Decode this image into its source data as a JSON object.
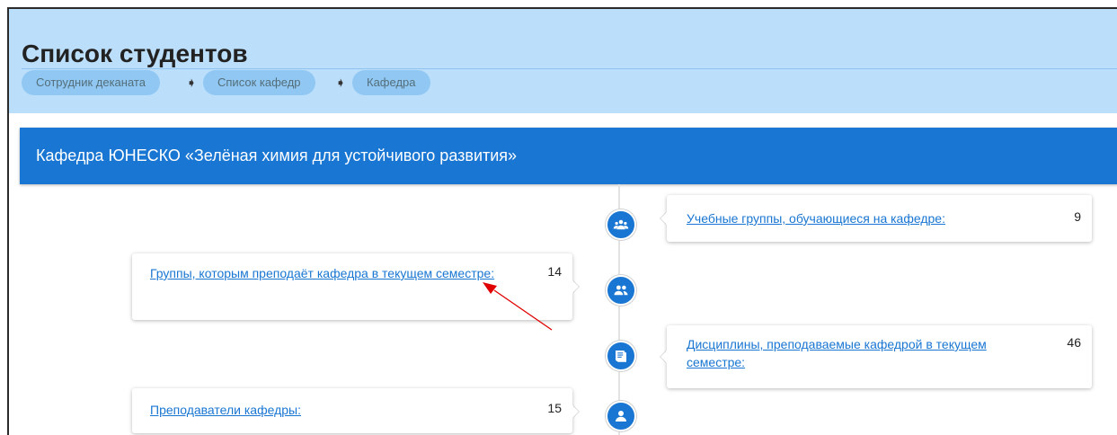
{
  "header": {
    "title": "Список студентов",
    "breadcrumbs": [
      "Сотрудник деканата",
      "Список кафедр",
      "Кафедра"
    ]
  },
  "department": {
    "title": "Кафедра ЮНЕСКО «Зелёная химия для устойчивого развития»"
  },
  "timeline": [
    {
      "label": "Учебные группы, обучающиеся на кафедре:",
      "count": "9",
      "side": "right",
      "icon": "group-icon"
    },
    {
      "label": "Группы, которым преподаёт кафедра в текущем семестре:",
      "count": "14",
      "side": "left",
      "icon": "people-icon"
    },
    {
      "label": "Дисциплины, преподаваемые кафедрой в текущем семестре:",
      "count": "46",
      "side": "right",
      "icon": "book-icon"
    },
    {
      "label": "Преподаватели кафедры:",
      "count": "15",
      "side": "left",
      "icon": "person-icon"
    }
  ],
  "colors": {
    "header_bg": "#bbdefb",
    "accent": "#1976d2",
    "breadcrumb_bg": "#90c8f3",
    "annotation_arrow": "#e00000"
  }
}
